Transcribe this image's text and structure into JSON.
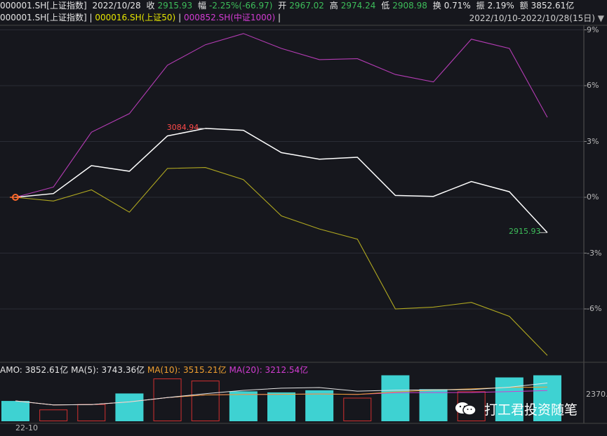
{
  "header": {
    "code": "000001.SH[上证指数]",
    "date": "2022/10/28",
    "close_label": "收",
    "close_value": "2915.93",
    "change_label": "幅",
    "change_value": "-2.25%(-66.97)",
    "open_label": "开",
    "open_value": "2967.02",
    "high_label": "高",
    "high_value": "2974.24",
    "low_label": "低",
    "low_value": "2908.98",
    "turnover_label": "换",
    "turnover_value": "0.71%",
    "amplitude_label": "振",
    "amplitude_value": "2.19%",
    "amount_label": "额",
    "amount_value": "3852.61亿"
  },
  "legend": {
    "s1": "000001.SH[上证指数]",
    "sep1": "|",
    "s2": "000016.SH(上证50)",
    "sep2": "|",
    "s3": "000852.SH(中证1000)",
    "sep3": "|"
  },
  "range_label": "2022/10/10-2022/10/28(15日)",
  "chart_data": {
    "type": "line",
    "x": [
      "2022-10-10",
      "2022-10-11",
      "2022-10-12",
      "2022-10-13",
      "2022-10-14",
      "2022-10-17",
      "2022-10-18",
      "2022-10-19",
      "2022-10-20",
      "2022-10-21",
      "2022-10-24",
      "2022-10-25",
      "2022-10-26",
      "2022-10-27",
      "2022-10-28"
    ],
    "ylim": [
      -8.5,
      9.5
    ],
    "yticks": [
      "9%",
      "6%",
      "3%",
      "0%",
      "-3%",
      "-6%"
    ],
    "ytick_values": [
      9,
      6,
      3,
      0,
      -3,
      -6
    ],
    "series": [
      {
        "name": "000001.SH[上证指数]",
        "color": "#ffffff",
        "values": [
          0,
          0.2,
          1.7,
          1.4,
          3.3,
          3.7,
          3.6,
          2.4,
          2.05,
          2.15,
          0.1,
          0.05,
          0.85,
          0.3,
          -1.9
        ]
      },
      {
        "name": "000016.SH(上证50)",
        "color": "#b0a820",
        "values": [
          0,
          -0.2,
          0.4,
          -0.8,
          1.55,
          1.6,
          0.95,
          -1.0,
          -1.7,
          -2.25,
          -6.0,
          -5.9,
          -5.65,
          -6.4,
          -8.5
        ]
      },
      {
        "name": "000852.SH(中证1000)",
        "color": "#b43cb4",
        "values": [
          0,
          0.55,
          3.5,
          4.5,
          7.1,
          8.2,
          8.8,
          8.0,
          7.4,
          7.45,
          6.6,
          6.2,
          8.5,
          8.0,
          4.3
        ]
      }
    ],
    "annotations": [
      {
        "text": "3084.94",
        "series": 0,
        "index": 5,
        "color": "#ff4a4a"
      },
      {
        "text": "2915.93",
        "series": 0,
        "index": 14,
        "color": "#3dbd5a"
      }
    ]
  },
  "volume": {
    "amo_label": "AMO: 3852.61亿",
    "ma5_label": "MA(5): 3743.36亿",
    "ma10_label": "MA(10): 3515.21亿",
    "ma20_label": "MA(20): 3212.54亿",
    "ytick": "2370.",
    "date_label": "22-10",
    "bars": [
      {
        "up": true,
        "value": 3550
      },
      {
        "up": false,
        "value": 3150
      },
      {
        "up": false,
        "value": 3400
      },
      {
        "up": true,
        "value": 3900
      },
      {
        "up": false,
        "value": 4600
      },
      {
        "up": false,
        "value": 4500
      },
      {
        "up": true,
        "value": 4000
      },
      {
        "up": true,
        "value": 3950
      },
      {
        "up": true,
        "value": 4050
      },
      {
        "up": false,
        "value": 3700
      },
      {
        "up": true,
        "value": 4750
      },
      {
        "up": true,
        "value": 4100
      },
      {
        "up": false,
        "value": 4000
      },
      {
        "up": true,
        "value": 4650
      },
      {
        "up": true,
        "value": 4750
      }
    ],
    "ma_colors": {
      "ma5": "#e6e6e6",
      "ma10": "#f0a030",
      "ma20": "#d23cd2"
    },
    "up_color": "#3ed2d2",
    "down_color": "#d23030"
  },
  "watermark": {
    "text": "打工君投资随笔",
    "icon": "wechat-icon"
  }
}
